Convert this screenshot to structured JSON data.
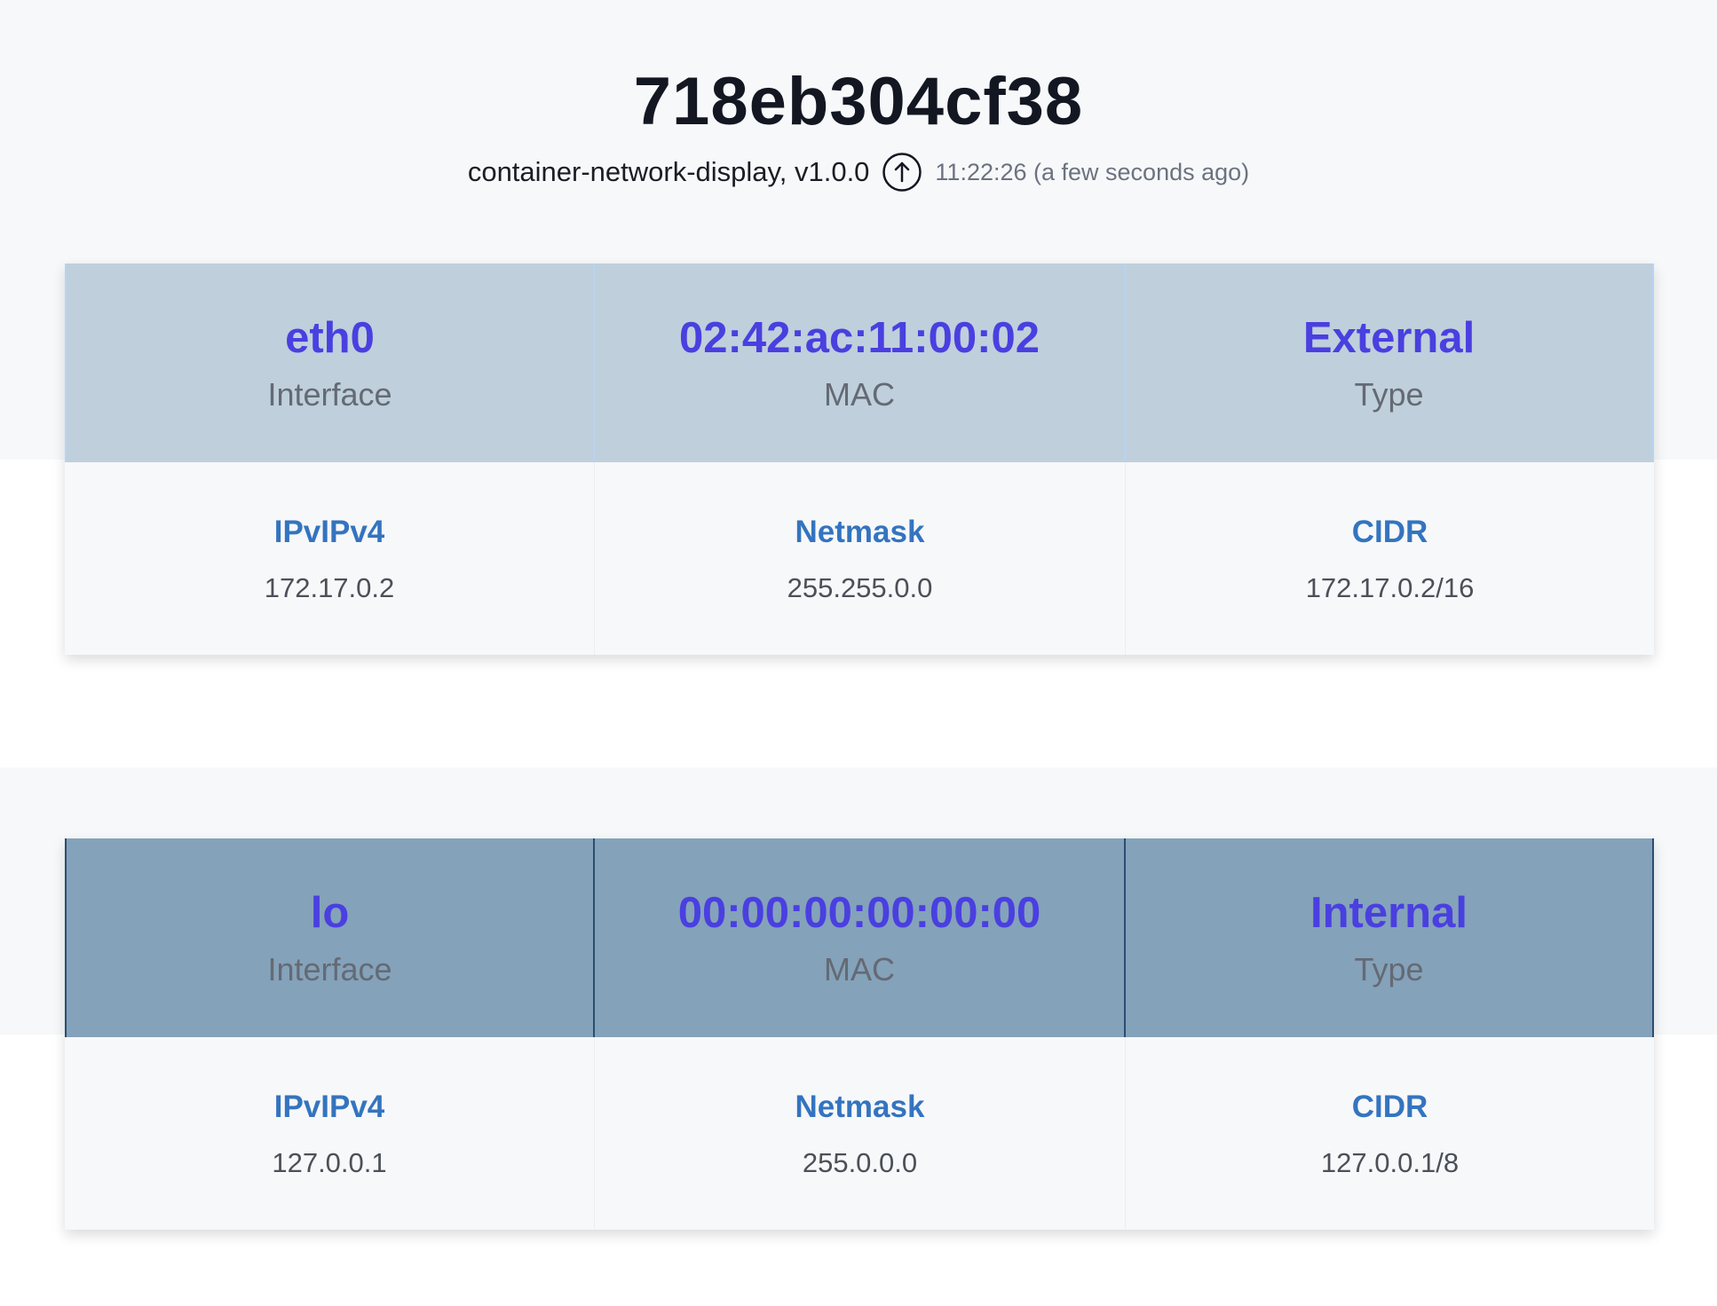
{
  "header": {
    "title": "718eb304cf38",
    "app_name": "container-network-display, v1.0.0",
    "timestamp": "11:22:26 (a few seconds ago)",
    "refresh_icon": "arrow-up-circle-icon"
  },
  "interfaces": [
    {
      "name": "eth0",
      "name_label": "Interface",
      "mac": "02:42:ac:11:00:02",
      "mac_label": "MAC",
      "type": "External",
      "type_label": "Type",
      "ip_label": "IPvIPv4",
      "ip": "172.17.0.2",
      "netmask_label": "Netmask",
      "netmask": "255.255.0.0",
      "cidr_label": "CIDR",
      "cidr": "172.17.0.2/16"
    },
    {
      "name": "lo",
      "name_label": "Interface",
      "mac": "00:00:00:00:00:00",
      "mac_label": "MAC",
      "type": "Internal",
      "type_label": "Type",
      "ip_label": "IPvIPv4",
      "ip": "127.0.0.1",
      "netmask_label": "Netmask",
      "netmask": "255.0.0.0",
      "cidr_label": "CIDR",
      "cidr": "127.0.0.1/8"
    }
  ],
  "colors": {
    "page_band": "#f7f8fa",
    "external_header": "#bfcfdc",
    "internal_header": "#84a2ba",
    "value_accent": "#4a3fe0",
    "label_accent": "#3474bf"
  }
}
